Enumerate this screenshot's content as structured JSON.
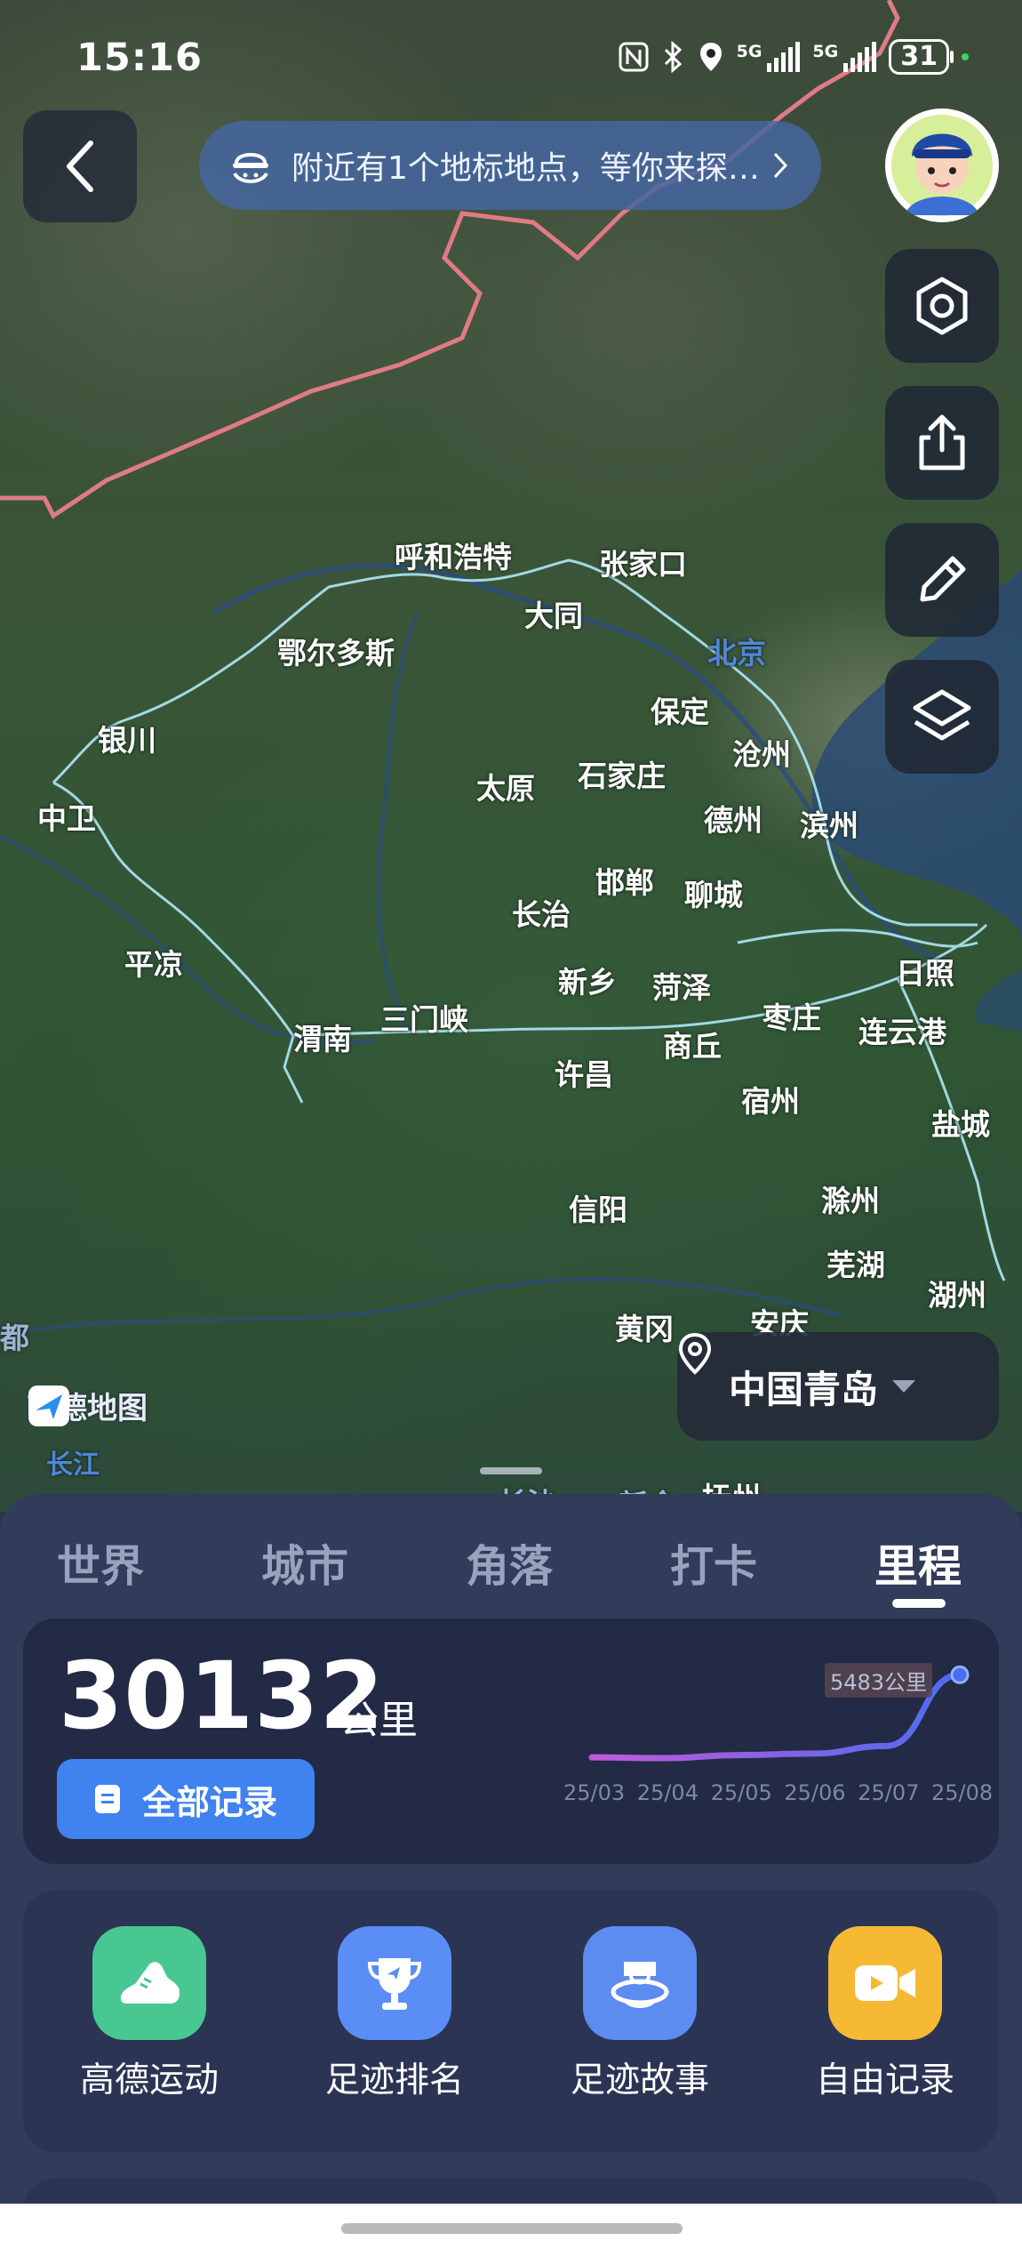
{
  "status_bar": {
    "time": "15:16",
    "icons": [
      "nfc-icon",
      "bluetooth-icon",
      "location-icon"
    ],
    "signal_1": "5G",
    "signal_2": "5G",
    "battery": "31"
  },
  "top_bar": {
    "notice": "附近有1个地标地点，等你来探…",
    "chevron": "›"
  },
  "map": {
    "cities": [
      "呼和浩特",
      "张家口",
      "大同",
      "北京",
      "鄂尔多斯",
      "保定",
      "银川",
      "沧州",
      "太原",
      "石家庄",
      "中卫",
      "德州",
      "滨州",
      "邯郸",
      "聊城",
      "长治",
      "平凉",
      "新乡",
      "菏泽",
      "日照",
      "三门峡",
      "渭南",
      "枣庄",
      "商丘",
      "连云港",
      "许昌",
      "宿州",
      "盐城",
      "信阳",
      "滁州",
      "芜湖",
      "黄冈",
      "安庆",
      "湖州",
      "都",
      "长江",
      "长沙",
      "新余",
      "抚州"
    ],
    "logo_text": "高德地图",
    "location": "中国青岛",
    "colors": {
      "border": "#e07b86",
      "route": "#aee8f5",
      "water": "#2a4a74"
    }
  },
  "tabs": [
    "世界",
    "城市",
    "角落",
    "打卡",
    "里程"
  ],
  "active_tab": "里程",
  "mileage": {
    "value": "30132",
    "unit": "公里",
    "all_records_label": "全部记录"
  },
  "chart_data": {
    "type": "line",
    "x": [
      "25/03",
      "25/04",
      "25/05",
      "25/06",
      "25/07",
      "25/08"
    ],
    "series": [
      {
        "values": [
          50,
          0,
          200,
          300,
          800,
          5483
        ]
      }
    ],
    "last_label": "5483公里",
    "ylim": [
      0,
      5500
    ],
    "gradient": [
      "#c05ad8",
      "#4b6cf0"
    ]
  },
  "tools": [
    {
      "label": "高德运动",
      "icon": "running-shoe-icon",
      "color": "#48c792"
    },
    {
      "label": "足迹排名",
      "icon": "trophy-icon",
      "color": "#5a8df5"
    },
    {
      "label": "足迹故事",
      "icon": "story-icon",
      "color": "#5d8cf0"
    },
    {
      "label": "自由记录",
      "icon": "video-record-icon",
      "color": "#f5b933"
    }
  ]
}
